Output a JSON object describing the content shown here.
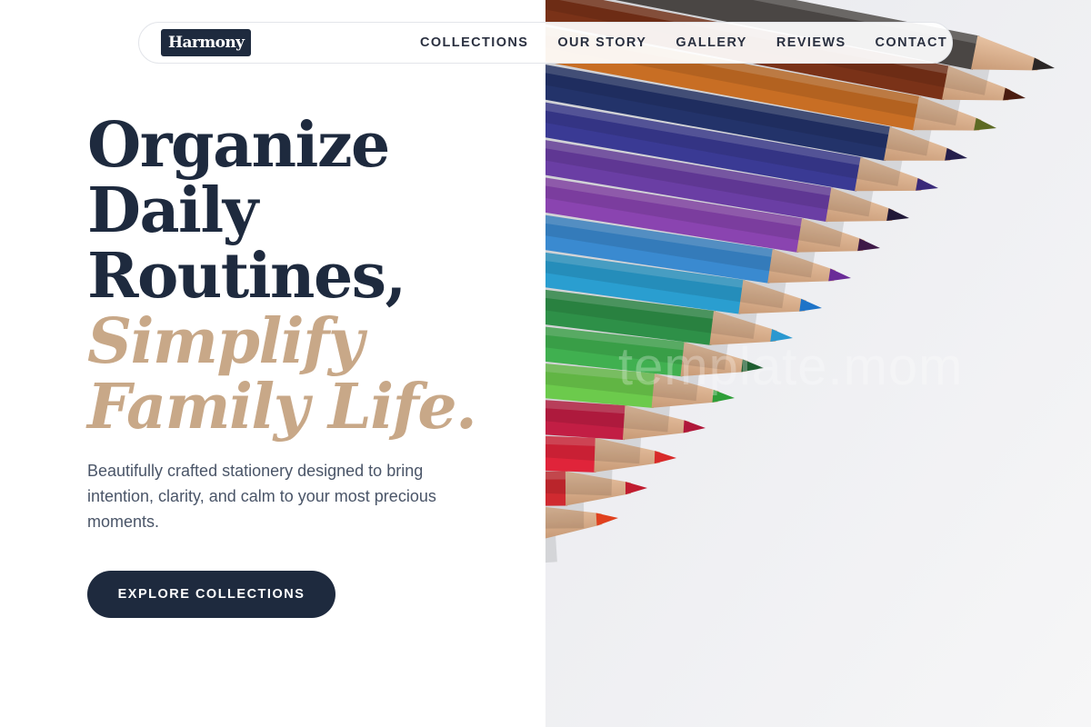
{
  "brand": {
    "logo": "Harmony"
  },
  "nav": {
    "items": [
      {
        "label": "COLLECTIONS"
      },
      {
        "label": "OUR STORY"
      },
      {
        "label": "GALLERY"
      },
      {
        "label": "REVIEWS"
      },
      {
        "label": "CONTACT"
      }
    ]
  },
  "hero": {
    "title_lines": [
      "Organize",
      "Daily",
      "Routines,"
    ],
    "accent_lines": [
      "Simplify",
      "Family Life."
    ],
    "description": "Beautifully crafted stationery designed to bring intention, clarity, and calm to your most precious moments.",
    "cta_label": "EXPLORE COLLECTIONS",
    "image_watermark": "template.mom"
  },
  "colors": {
    "primary": "#1e2a3e",
    "accent": "#c8a888",
    "body_text": "#4a5568",
    "nav_text": "#2a3040"
  },
  "image": {
    "subject": "colored pencils",
    "pencils": [
      {
        "color": "#4a4644",
        "tip": "#2a2626"
      },
      {
        "color": "#7a3218",
        "tip": "#4a1c10"
      },
      {
        "color": "#c86e24",
        "tip": "#5c6a24"
      },
      {
        "color": "#23336a",
        "tip": "#241e4c"
      },
      {
        "color": "#3a3a94",
        "tip": "#3a2a7a"
      },
      {
        "color": "#6a3ea4",
        "tip": "#201838"
      },
      {
        "color": "#8a44b0",
        "tip": "#3e1a48"
      },
      {
        "color": "#3a8ad0",
        "tip": "#6a2c98"
      },
      {
        "color": "#2a9ed0",
        "tip": "#1e74c8"
      },
      {
        "color": "#2e9048",
        "tip": "#2a98d0"
      },
      {
        "color": "#40b050",
        "tip": "#1e5e30"
      },
      {
        "color": "#6cca4c",
        "tip": "#2e9e38"
      },
      {
        "color": "#c21e44",
        "tip": "#b0183a"
      },
      {
        "color": "#e0243a",
        "tip": "#d82a2a"
      },
      {
        "color": "#d02a30",
        "tip": "#c01c30"
      },
      {
        "color": "#ee4424",
        "tip": "#e0401e"
      }
    ]
  }
}
